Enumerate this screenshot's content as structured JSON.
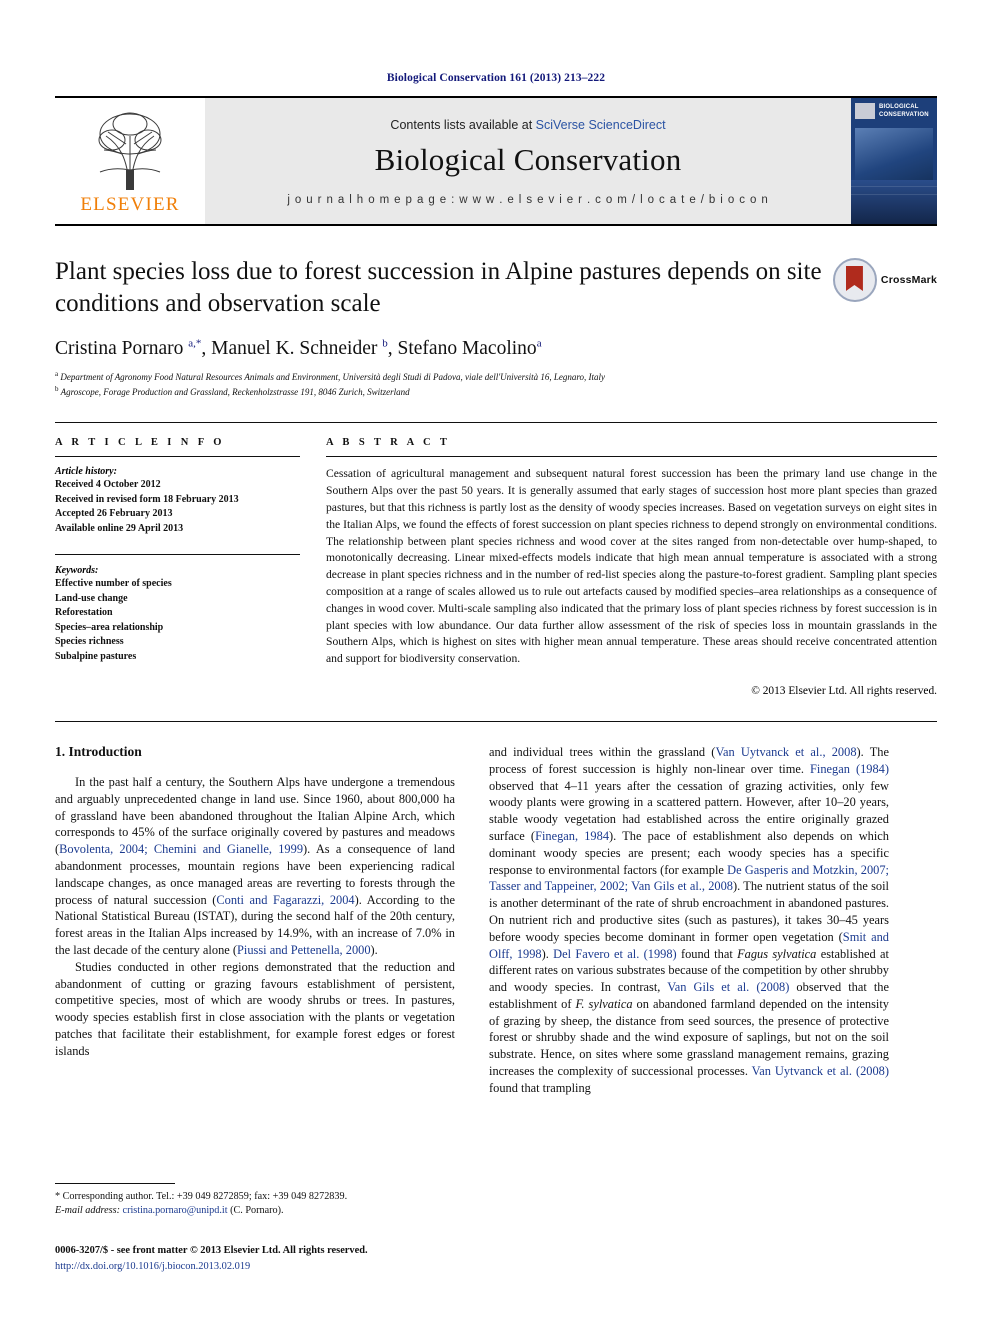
{
  "running_head": "Biological Conservation 161 (2013) 213–222",
  "masthead": {
    "publisher_name": "ELSEVIER",
    "contents_prefix": "Contents lists available at ",
    "contents_link": "SciVerse ScienceDirect",
    "journal_title": "Biological Conservation",
    "homepage_line": "j o u r n a l  h o m e p a g e :  w w w . e l s e v i e r . c o m / l o c a t e / b i o c o n",
    "cover_title": "BIOLOGICAL CONSERVATION"
  },
  "article": {
    "title": "Plant species loss due to forest succession in Alpine pastures depends on site conditions and observation scale",
    "authors_html": "Cristina Pornaro <sup>a,*</sup>, Manuel K. Schneider <sup>b</sup>, Stefano Macolino<sup>a</sup>",
    "affiliation_a": "Department of Agronomy Food Natural Resources Animals and Environment, Università degli Studi di Padova, viale dell'Università 16, Legnaro, Italy",
    "affiliation_b": "Agroscope, Forage Production and Grassland, Reckenholzstrasse 191, 8046 Zurich, Switzerland",
    "crossmark_label": "CrossMark"
  },
  "article_info": {
    "heading": "A R T I C L E   I N F O",
    "history_heading": "Article history:",
    "history": [
      "Received 4 October 2012",
      "Received in revised form 18 February 2013",
      "Accepted 26 February 2013",
      "Available online 29 April 2013"
    ],
    "keywords_heading": "Keywords:",
    "keywords": [
      "Effective number of species",
      "Land-use change",
      "Reforestation",
      "Species–area relationship",
      "Species richness",
      "Subalpine pastures"
    ]
  },
  "abstract": {
    "heading": "A B S T R A C T",
    "text": "Cessation of agricultural management and subsequent natural forest succession has been the primary land use change in the Southern Alps over the past 50 years. It is generally assumed that early stages of succession host more plant species than grazed pastures, but that this richness is partly lost as the density of woody species increases. Based on vegetation surveys on eight sites in the Italian Alps, we found the effects of forest succession on plant species richness to depend strongly on environmental conditions. The relationship between plant species richness and wood cover at the sites ranged from non-detectable over hump-shaped, to monotonically decreasing. Linear mixed-effects models indicate that high mean annual temperature is associated with a strong decrease in plant species richness and in the number of red-list species along the pasture-to-forest gradient. Sampling plant species composition at a range of scales allowed us to rule out artefacts caused by modified species–area relationships as a consequence of changes in wood cover. Multi-scale sampling also indicated that the primary loss of plant species richness by forest succession is in plant species with low abundance. Our data further allow assessment of the risk of species loss in mountain grasslands in the Southern Alps, which is highest on sites with higher mean annual temperature. These areas should receive concentrated attention and support for biodiversity conservation.",
    "copyright": "© 2013 Elsevier Ltd. All rights reserved."
  },
  "introduction": {
    "heading": "1. Introduction",
    "left_paragraph_1_a": "In the past half a century, the Southern Alps have undergone a tremendous and arguably unprecedented change in land use. Since 1960, about 800,000 ha of grassland have been abandoned throughout the Italian Alpine Arch, which corresponds to 45% of the surface originally covered by pastures and meadows (",
    "cite_bovolenta": "Bovolenta, 2004; Chemini and Gianelle, 1999",
    "left_paragraph_1_b": "). As a consequence of land abandonment processes, mountain regions have been experiencing radical landscape changes, as once managed areas are reverting to forests through the process of natural succession (",
    "cite_conti": "Conti and Fagarazzi, 2004",
    "left_paragraph_1_c": "). According to the National Statistical Bureau (ISTAT), during the second half of the 20th century, forest areas in the Italian Alps increased by 14.9%, with an increase of 7.0% in the last decade of the century alone (",
    "cite_piussi": "Piussi and Pettenella, 2000",
    "left_paragraph_1_d": ").",
    "left_paragraph_2": "Studies conducted in other regions demonstrated that the reduction and abandonment of cutting or grazing favours establishment of persistent, competitive species, most of which are woody shrubs or trees. In pastures, woody species establish first in close association with the plants or vegetation patches that facilitate their establishment, for example forest edges or forest islands",
    "right_a": "and individual trees within the grassland (",
    "cite_vanuytvanck": "Van Uytvanck et al., 2008",
    "right_b": "). The process of forest succession is highly non-linear over time. ",
    "cite_finegan_1984": "Finegan (1984)",
    "right_c": " observed that 4–11 years after the cessation of grazing activities, only few woody plants were growing in a scattered pattern. However, after 10–20 years, stable woody vegetation had established across the entire originally grazed surface (",
    "cite_finegan_paren": "Finegan, 1984",
    "right_d": "). The pace of establishment also depends on which dominant woody species are present; each woody species has a specific response to environmental factors (for example ",
    "cite_degasperis": "De Gasperis and Motzkin, 2007; Tasser and Tappeiner, 2002; Van Gils et al., 2008",
    "right_e": "). The nutrient status of the soil is another determinant of the rate of shrub encroachment in abandoned pastures. On nutrient rich and productive sites (such as pastures), it takes 30–45 years before woody species become dominant in former open vegetation (",
    "cite_smit": "Smit and Olff, 1998",
    "right_f": "). ",
    "cite_delfavero": "Del Favero et al. (1998)",
    "right_g": " found that ",
    "species_fagus": "Fagus sylvatica",
    "right_h": " established at different rates on various substrates because of the competition by other shrubby and woody species. In contrast, ",
    "cite_vangils": "Van Gils et al. (2008)",
    "right_i": " observed that the establishment of ",
    "species_fsylvatica": "F. sylvatica",
    "right_j": " on abandoned farmland depended on the intensity of grazing by sheep, the distance from seed sources, the presence of protective forest or shrubby shade and the wind exposure of saplings, but not on the soil substrate. Hence, on sites where some grassland management remains, grazing increases the complexity of successional processes. ",
    "cite_vanuytvanck2": "Van Uytvanck et al. (2008)",
    "right_k": " found that trampling"
  },
  "footnotes": {
    "corresponding": "* Corresponding author. Tel.: +39 049 8272859; fax: +39 049 8272839.",
    "email_label": "E-mail address:",
    "email": "cristina.pornaro@unipd.it",
    "email_suffix": " (C. Pornaro)."
  },
  "footer": {
    "issn_line": "0006-3207/$ - see front matter © 2013 Elsevier Ltd. All rights reserved.",
    "doi": "http://dx.doi.org/10.1016/j.biocon.2013.02.019"
  },
  "colors": {
    "link_blue": "#1b3a8f",
    "running_head_blue": "#13197a",
    "elsevier_orange": "#f07f09",
    "cover_navy": "#1d3f7a",
    "masthead_grey": "#e9e9e9"
  }
}
